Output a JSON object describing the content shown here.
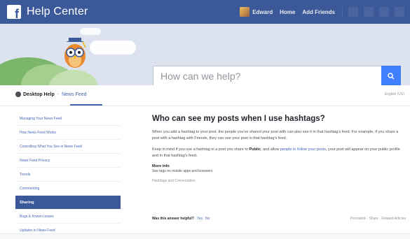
{
  "app": {
    "brand": "Help Center",
    "logo_letter": "f"
  },
  "topbar": {
    "user_name": "Edward",
    "link_2": "Home",
    "link_3": "Add Friends",
    "icons": [
      "friend-requests-icon",
      "messages-icon",
      "notifications-icon",
      "dropdown-icon"
    ]
  },
  "search": {
    "placeholder": "How can we help?",
    "button_icon": "search-icon"
  },
  "breadcrumbs": {
    "desktop": "Desktop Help",
    "news": "News Feed",
    "language": "English (US)"
  },
  "sidebar": {
    "items": [
      {
        "label": "Managing Your News Feed"
      },
      {
        "label": "How News Feed Works"
      },
      {
        "label": "Controlling What You See in News Feed"
      },
      {
        "label": "News Feed Privacy"
      },
      {
        "label": "Trends"
      },
      {
        "label": "Commenting"
      },
      {
        "label": "Sharing",
        "selected": true
      },
      {
        "label": "Bugs & Known Issues"
      },
      {
        "label": "Updates in News Feed"
      }
    ]
  },
  "article": {
    "title": "Who can see my posts when I use hashtags?",
    "para1": "When you add a hashtag to your post, the people you've shared your post with can also see it in that hashtag's feed. For example, if you share a post with a hashtag with Friends, they can see your post in that hashtag's feed.",
    "para2_start": "Keep in mind if you use a hashtag in a post you share to ",
    "para2_public": "Public",
    "para2_middle": ", and allow ",
    "para2_link": "people to follow your posts",
    "para2_end": ", your post will appear on your public profile and in that hashtag's feed.",
    "more_info_head": "More info",
    "more_info_link": "See tags on mobile apps and browsers",
    "more_info_link2": "Hashtags and Conversation"
  },
  "feedback": {
    "question": "Was this answer helpful?",
    "yes": "Yes",
    "no": "No",
    "right": "Permalink · Share · Related Articles"
  },
  "colors": {
    "topbar": "#3b5998",
    "accent": "#4080ff",
    "link": "#4267b2",
    "selected": "#3b5998"
  }
}
